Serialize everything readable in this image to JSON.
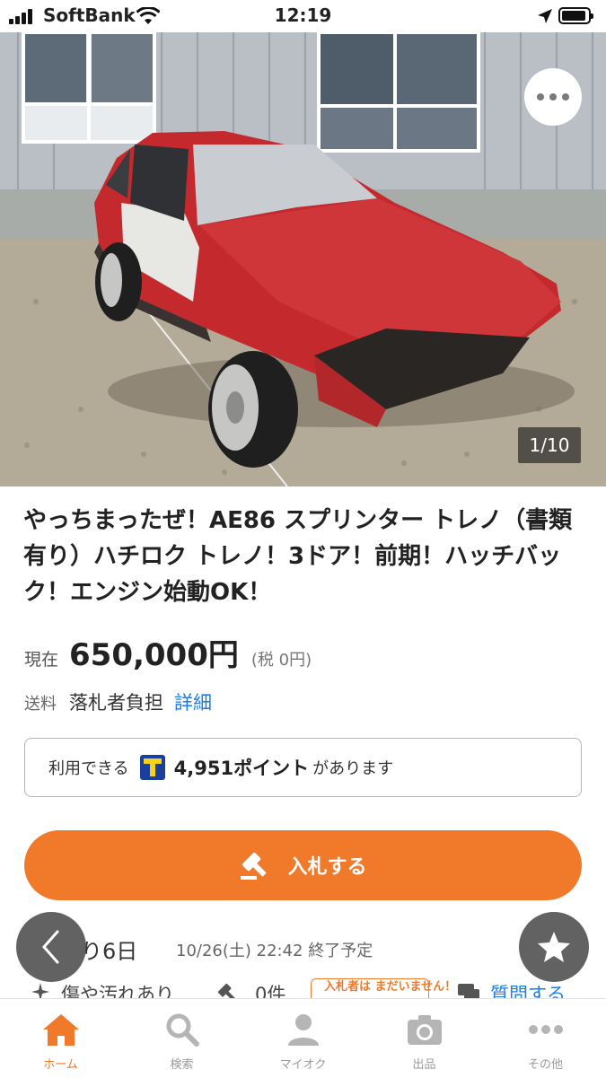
{
  "status_bar": {
    "carrier": "SoftBank",
    "time": "12:19"
  },
  "gallery": {
    "counter": "1/10",
    "more_icon": "more-dots-icon"
  },
  "item": {
    "title": "やっちまったぜ！AE86 スプリンター トレノ（書類有り）ハチロク トレノ！3ドア！前期！ハッチバック！エンジン始動OK！",
    "price_label": "現在",
    "price": "650,000円",
    "tax": "(税 0円)",
    "shipping_label": "送料",
    "shipping_value": "落札者負担",
    "shipping_link": "詳細"
  },
  "points": {
    "prefix": "利用できる",
    "value": "4,951ポイント",
    "suffix": "があります"
  },
  "bid_button": {
    "label": "入札する",
    "icon": "gavel-icon"
  },
  "auction": {
    "remaining": "り6日",
    "end_time": "10/26(土) 22:42 終了予定",
    "condition": "傷や汚れあり",
    "bid_count": "0件",
    "no_bidders_badge": "入札者は まだいません！",
    "questions_link": "質問する"
  },
  "tabs": [
    {
      "label": "ホーム",
      "icon": "home-icon",
      "active": true
    },
    {
      "label": "検索",
      "icon": "search-icon",
      "active": false
    },
    {
      "label": "マイオク",
      "icon": "person-icon",
      "active": false
    },
    {
      "label": "出品",
      "icon": "camera-icon",
      "active": false
    },
    {
      "label": "その他",
      "icon": "more-dots-icon",
      "active": false
    }
  ],
  "colors": {
    "accent": "#f07a2a",
    "link": "#1a7ee8",
    "car_red": "#c42a2d"
  }
}
